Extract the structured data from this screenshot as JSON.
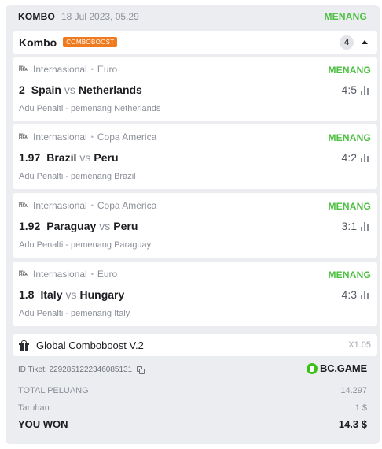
{
  "header": {
    "type": "KOMBO",
    "date": "18 Jul 2023, 05.29",
    "status": "MENANG"
  },
  "combo": {
    "title": "Kombo",
    "boost_badge": "COMBOBOOST",
    "count": "4"
  },
  "bets": [
    {
      "league": "Internasional",
      "competition": "Euro",
      "status": "MENANG",
      "odds": "2",
      "home": "Spain",
      "vs": "vs",
      "away": "Netherlands",
      "score": "4:5",
      "market": "Adu Penalti - pemenang Netherlands"
    },
    {
      "league": "Internasional",
      "competition": "Copa America",
      "status": "MENANG",
      "odds": "1.97",
      "home": "Brazil",
      "vs": "vs",
      "away": "Peru",
      "score": "4:2",
      "market": "Adu Penalti - pemenang Brazil"
    },
    {
      "league": "Internasional",
      "competition": "Copa America",
      "status": "MENANG",
      "odds": "1.92",
      "home": "Paraguay",
      "vs": "vs",
      "away": "Peru",
      "score": "3:1",
      "market": "Adu Penalti - pemenang Paraguay"
    },
    {
      "league": "Internasional",
      "competition": "Euro",
      "status": "MENANG",
      "odds": "1.8",
      "home": "Italy",
      "vs": "vs",
      "away": "Hungary",
      "score": "4:3",
      "market": "Adu Penalti - pemenang Italy"
    }
  ],
  "league_logo": {
    "top": "FIFA",
    "bottom": "FIFA"
  },
  "boost": {
    "label": "Global Comboboost V.2",
    "multiplier": "X1.05"
  },
  "ticket": {
    "id_label": "ID Tiket:",
    "id": "2292851222346085131"
  },
  "brand": {
    "name": "BC.GAME",
    "color": "#3bc117"
  },
  "summary": {
    "total_odds_label": "TOTAL PELUANG",
    "total_odds": "14.297",
    "stake_label": "Taruhan",
    "stake": "1 $",
    "won_label": "YOU WON",
    "won": "14.3 $"
  },
  "colors": {
    "win": "#4bbf3f",
    "boost_badge": "#f07a1f",
    "panel": "#ebedf0"
  }
}
